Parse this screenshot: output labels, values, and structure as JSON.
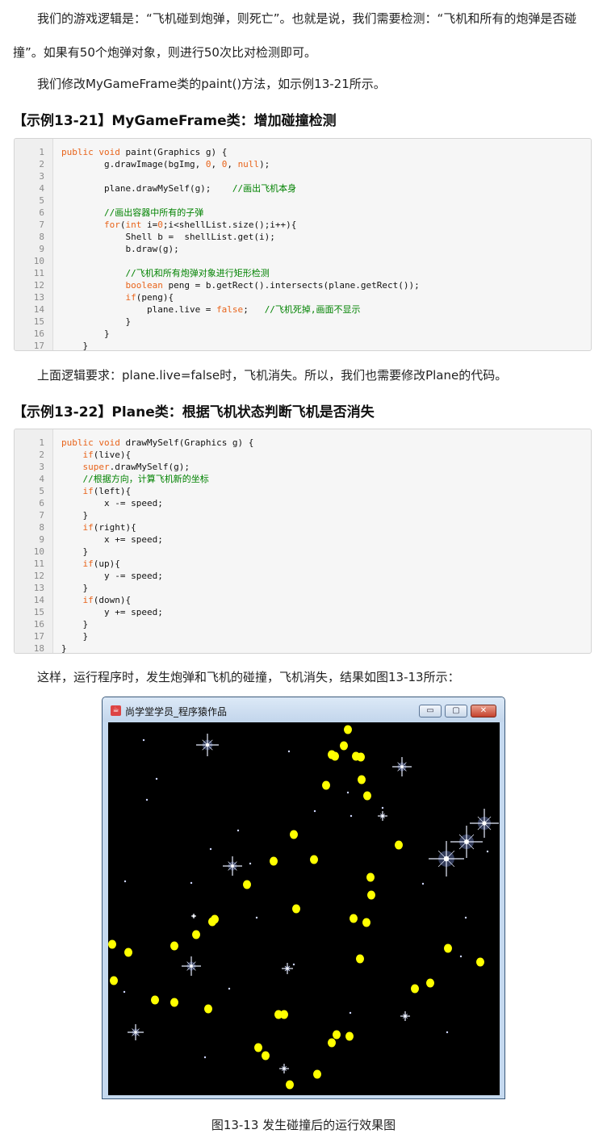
{
  "intro": {
    "p1": "我们的游戏逻辑是：“飞机碰到炮弹，则死亡”。也就是说，我们需要检测：“飞机和所有的炮弹是否碰撞”。如果有50个炮弹对象，则进行50次比对检测即可。",
    "p2": "我们修改MyGameFrame类的paint()方法，如示例13-21所示。"
  },
  "example1": {
    "heading": "【示例13-21】MyGameFrame类：增加碰撞检测",
    "line_numbers": [
      "1",
      "2",
      "3",
      "4",
      "5",
      "6",
      "7",
      "8",
      "9",
      "10",
      "11",
      "12",
      "13",
      "14",
      "15",
      "16",
      "17"
    ],
    "lines": [
      [
        {
          "t": "public void",
          "c": "kw"
        },
        {
          "t": " paint(Graphics g) {",
          "c": ""
        }
      ],
      [
        {
          "t": "        g.drawImage(bgImg, ",
          "c": ""
        },
        {
          "t": "0",
          "c": "nm"
        },
        {
          "t": ", ",
          "c": ""
        },
        {
          "t": "0",
          "c": "nm"
        },
        {
          "t": ", ",
          "c": ""
        },
        {
          "t": "null",
          "c": "kw"
        },
        {
          "t": ");",
          "c": ""
        }
      ],
      [
        {
          "t": "",
          "c": ""
        }
      ],
      [
        {
          "t": "        plane.drawMySelf(g);    ",
          "c": ""
        },
        {
          "t": "//画出飞机本身",
          "c": "cm"
        }
      ],
      [
        {
          "t": "",
          "c": ""
        }
      ],
      [
        {
          "t": "        ",
          "c": ""
        },
        {
          "t": "//画出容器中所有的子弹",
          "c": "cm"
        }
      ],
      [
        {
          "t": "        ",
          "c": ""
        },
        {
          "t": "for",
          "c": "kw"
        },
        {
          "t": "(",
          "c": ""
        },
        {
          "t": "int",
          "c": "kw"
        },
        {
          "t": " i=",
          "c": ""
        },
        {
          "t": "0",
          "c": "nm"
        },
        {
          "t": ";i<shellList.size();i++){",
          "c": ""
        }
      ],
      [
        {
          "t": "            Shell b =  shellList.get(i);",
          "c": ""
        }
      ],
      [
        {
          "t": "            b.draw(g);",
          "c": ""
        }
      ],
      [
        {
          "t": "",
          "c": ""
        }
      ],
      [
        {
          "t": "            ",
          "c": ""
        },
        {
          "t": "//飞机和所有炮弹对象进行矩形检测",
          "c": "cm"
        }
      ],
      [
        {
          "t": "            ",
          "c": ""
        },
        {
          "t": "boolean",
          "c": "kw"
        },
        {
          "t": " peng = b.getRect().intersects(plane.getRect());",
          "c": ""
        }
      ],
      [
        {
          "t": "            ",
          "c": ""
        },
        {
          "t": "if",
          "c": "kw"
        },
        {
          "t": "(peng){",
          "c": ""
        }
      ],
      [
        {
          "t": "                plane.live = ",
          "c": ""
        },
        {
          "t": "false",
          "c": "kw"
        },
        {
          "t": ";   ",
          "c": ""
        },
        {
          "t": "//飞机死掉,画面不显示",
          "c": "cm"
        }
      ],
      [
        {
          "t": "            }",
          "c": ""
        }
      ],
      [
        {
          "t": "        }",
          "c": ""
        }
      ],
      [
        {
          "t": "    }",
          "c": ""
        }
      ]
    ]
  },
  "middle": {
    "p3": "上面逻辑要求：plane.live=false时，飞机消失。所以，我们也需要修改Plane的代码。"
  },
  "example2": {
    "heading": "【示例13-22】Plane类：根据飞机状态判断飞机是否消失",
    "line_numbers": [
      "1",
      "2",
      "3",
      "4",
      "5",
      "6",
      "7",
      "8",
      "9",
      "10",
      "11",
      "12",
      "13",
      "14",
      "15",
      "16",
      "17",
      "18"
    ],
    "lines": [
      [
        {
          "t": "public void",
          "c": "kw"
        },
        {
          "t": " drawMySelf(Graphics g) {",
          "c": ""
        }
      ],
      [
        {
          "t": "    ",
          "c": ""
        },
        {
          "t": "if",
          "c": "kw"
        },
        {
          "t": "(live){",
          "c": ""
        }
      ],
      [
        {
          "t": "    ",
          "c": ""
        },
        {
          "t": "super",
          "c": "kw"
        },
        {
          "t": ".drawMySelf(g);",
          "c": ""
        }
      ],
      [
        {
          "t": "    ",
          "c": ""
        },
        {
          "t": "//根据方向，计算飞机新的坐标",
          "c": "cm"
        }
      ],
      [
        {
          "t": "    ",
          "c": ""
        },
        {
          "t": "if",
          "c": "kw"
        },
        {
          "t": "(left){",
          "c": ""
        }
      ],
      [
        {
          "t": "        x -= speed;",
          "c": ""
        }
      ],
      [
        {
          "t": "    }",
          "c": ""
        }
      ],
      [
        {
          "t": "    ",
          "c": ""
        },
        {
          "t": "if",
          "c": "kw"
        },
        {
          "t": "(right){",
          "c": ""
        }
      ],
      [
        {
          "t": "        x += speed;",
          "c": ""
        }
      ],
      [
        {
          "t": "    }",
          "c": ""
        }
      ],
      [
        {
          "t": "    ",
          "c": ""
        },
        {
          "t": "if",
          "c": "kw"
        },
        {
          "t": "(up){",
          "c": ""
        }
      ],
      [
        {
          "t": "        y -= speed;",
          "c": ""
        }
      ],
      [
        {
          "t": "    }",
          "c": ""
        }
      ],
      [
        {
          "t": "    ",
          "c": ""
        },
        {
          "t": "if",
          "c": "kw"
        },
        {
          "t": "(down){",
          "c": ""
        }
      ],
      [
        {
          "t": "        y += speed;",
          "c": ""
        }
      ],
      [
        {
          "t": "    }",
          "c": ""
        }
      ],
      [
        {
          "t": "    }",
          "c": ""
        }
      ],
      [
        {
          "t": "}",
          "c": ""
        }
      ]
    ]
  },
  "outro": {
    "p4": "这样，运行程序时，发生炮弹和飞机的碰撞，飞机消失，结果如图13-13所示："
  },
  "game_window": {
    "title": "尚学堂学员_程序猿作品",
    "minimize_glyph": "▭",
    "maximize_glyph": "▢",
    "close_glyph": "✕",
    "shell_color": "#ffff00",
    "background_color": "#000000"
  },
  "caption": "图13-13 发生碰撞后的运行效果图"
}
